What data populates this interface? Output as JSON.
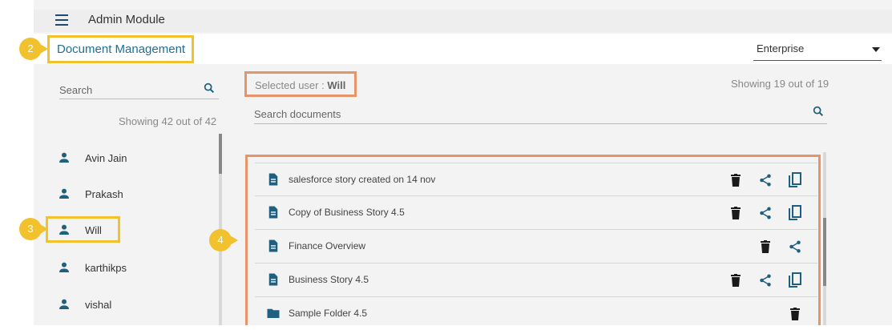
{
  "app": {
    "title": "Admin Module"
  },
  "page": {
    "title": "Document Management"
  },
  "badges": [
    "2",
    "3",
    "4"
  ],
  "enterprise": {
    "selected": "Enterprise"
  },
  "users_panel": {
    "search_placeholder": "Search",
    "showing": "Showing 42 out of 42",
    "users": [
      "Avin Jain",
      "Prakash",
      "Will",
      "karthikps",
      "vishal"
    ]
  },
  "documents_panel": {
    "selected_user_label": "Selected user : ",
    "selected_user_name": "Will",
    "showing": "Showing 19 out of 19",
    "search_placeholder": "Search documents",
    "items": [
      {
        "name": "salesforce story created on 14 nov",
        "type": "story",
        "actions": [
          "delete",
          "share",
          "copy"
        ]
      },
      {
        "name": "Copy of Business Story 4.5",
        "type": "story",
        "actions": [
          "delete",
          "share",
          "copy"
        ]
      },
      {
        "name": "Finance Overview",
        "type": "story",
        "actions": [
          "delete",
          "share"
        ]
      },
      {
        "name": "Business Story 4.5",
        "type": "story",
        "actions": [
          "delete",
          "share",
          "copy"
        ]
      },
      {
        "name": "Sample Folder 4.5",
        "type": "folder",
        "actions": [
          "delete"
        ]
      }
    ]
  },
  "colors": {
    "accent": "#1f5f7f",
    "highlight_yellow": "#f2c12e",
    "highlight_orange": "#e8946a"
  }
}
